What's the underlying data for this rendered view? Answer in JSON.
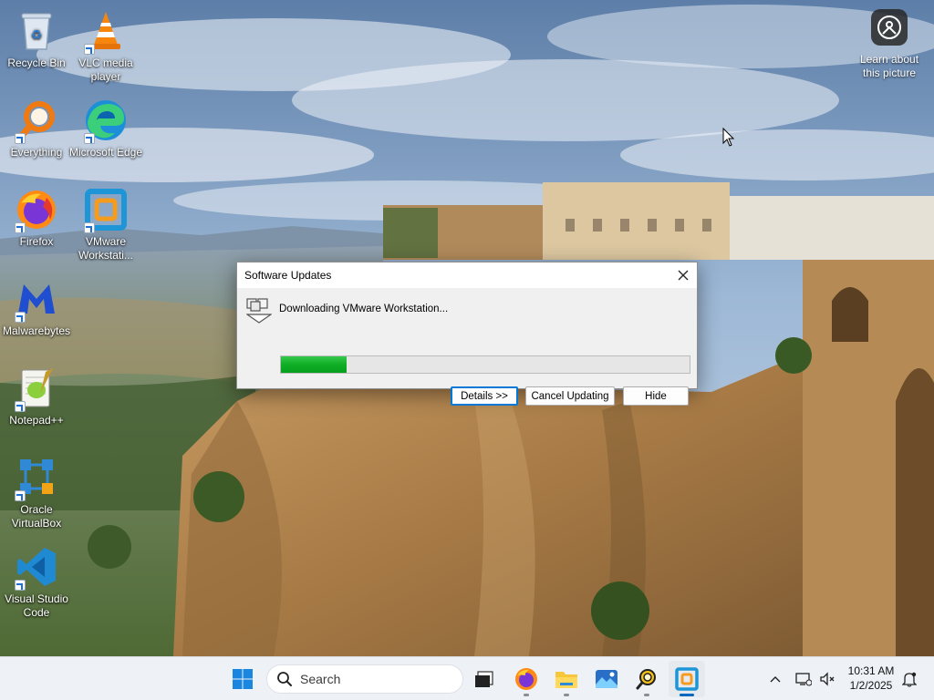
{
  "desktop": {
    "icons": [
      {
        "label": "Recycle Bin",
        "icon": "recycle-bin-icon"
      },
      {
        "label": "VLC media player",
        "icon": "vlc-icon"
      },
      {
        "label": "Everything",
        "icon": "everything-search-icon"
      },
      {
        "label": "Microsoft Edge",
        "icon": "edge-icon"
      },
      {
        "label": "Firefox",
        "icon": "firefox-icon"
      },
      {
        "label": "VMware Workstati...",
        "icon": "vmware-icon"
      },
      {
        "label": "Malwarebytes",
        "icon": "malwarebytes-icon"
      },
      {
        "label": "Notepad++",
        "icon": "notepadpp-icon"
      },
      {
        "label": "Oracle VirtualBox",
        "icon": "virtualbox-icon"
      },
      {
        "label": "Visual Studio Code",
        "icon": "vscode-icon"
      }
    ],
    "learn_widget": {
      "label": "Learn about this picture",
      "icon": "camera-icon"
    }
  },
  "dialog": {
    "title": "Software Updates",
    "message": "Downloading VMware Workstation...",
    "progress": 0.16,
    "buttons": {
      "details": "Details >>",
      "cancel": "Cancel Updating",
      "hide": "Hide"
    },
    "progress_color": "#0fae25"
  },
  "taskbar": {
    "search_placeholder": "Search",
    "apps": [
      "start-icon",
      "task-view-icon",
      "firefox-icon",
      "file-explorer-icon",
      "photos-icon",
      "everything-search-icon",
      "vmware-icon"
    ],
    "clock": {
      "time": "10:31 AM",
      "date": "1/2/2025"
    },
    "accent": "#0067c0"
  }
}
